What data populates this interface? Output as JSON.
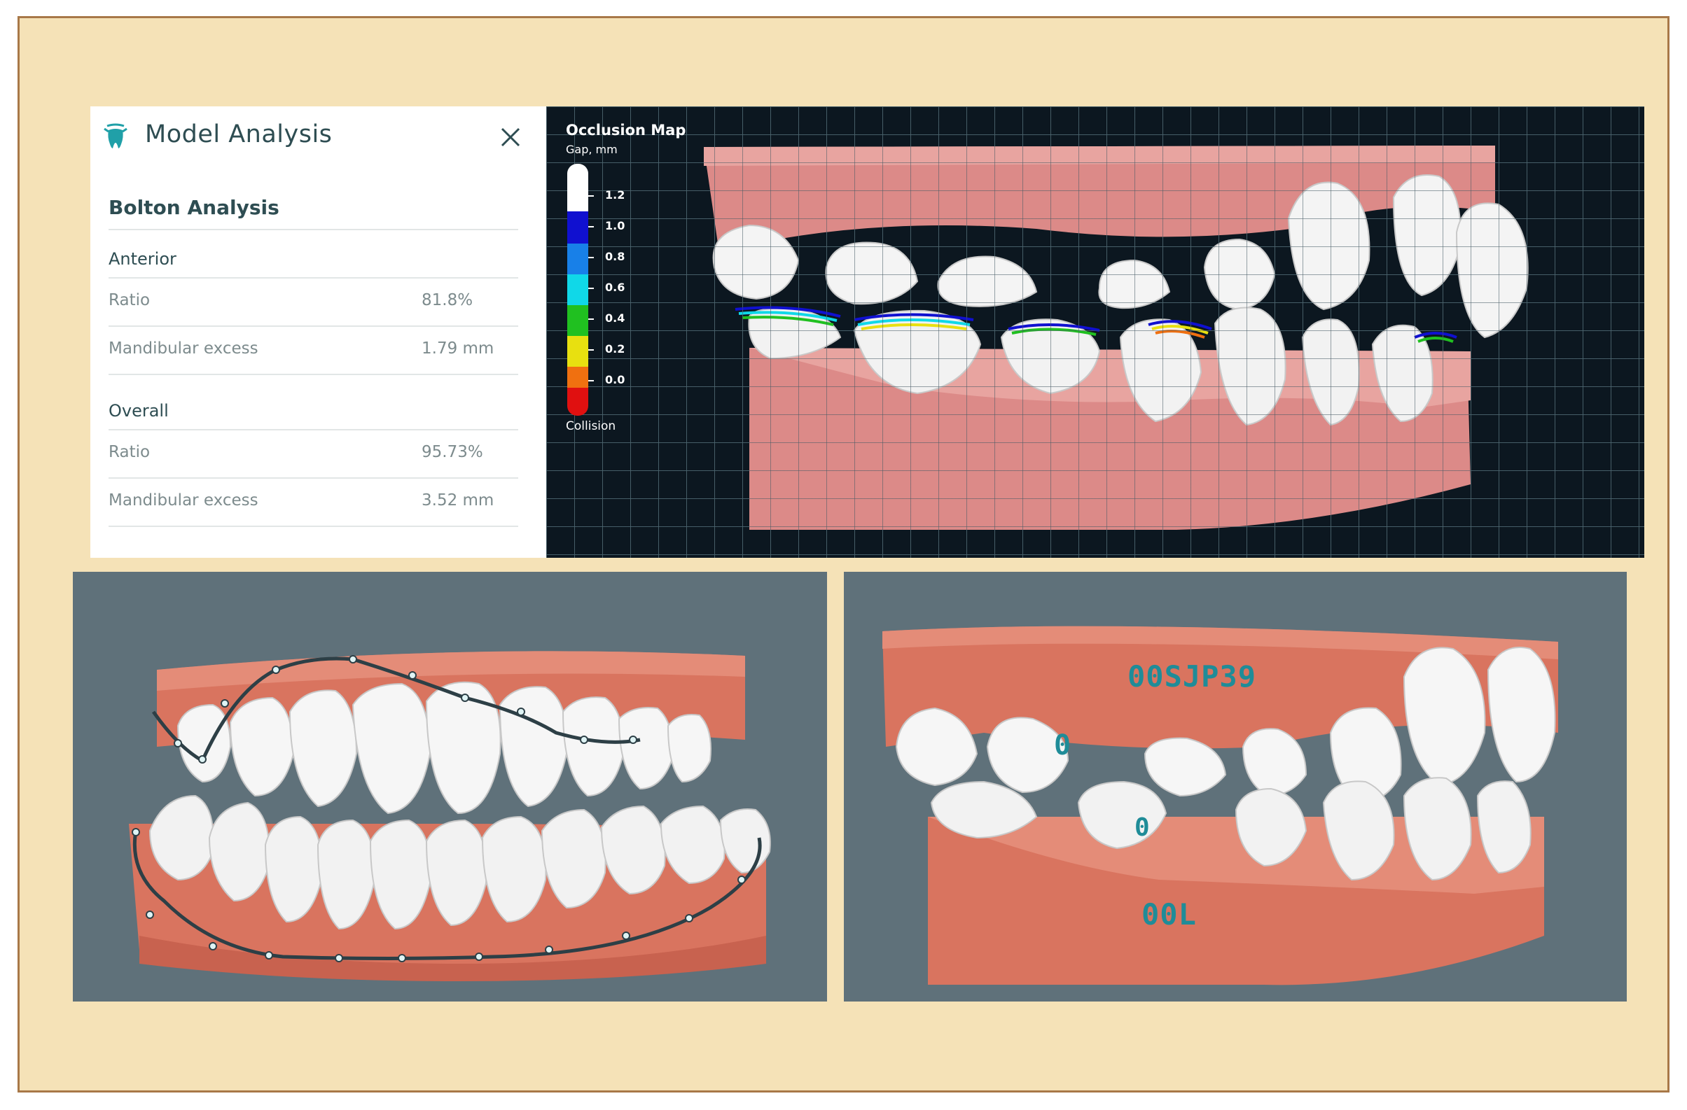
{
  "panel": {
    "title": "Model Analysis",
    "icon": "tooth-icon",
    "close_icon": "close-icon",
    "section": "Bolton Analysis",
    "groups": [
      {
        "label": "Anterior",
        "rows": [
          {
            "label": "Ratio",
            "value": "81.8%"
          },
          {
            "label": "Mandibular excess",
            "value": "1.79 mm"
          }
        ]
      },
      {
        "label": "Overall",
        "rows": [
          {
            "label": "Ratio",
            "value": "95.73%"
          },
          {
            "label": "Mandibular excess",
            "value": "3.52 mm"
          }
        ]
      }
    ]
  },
  "occlusion": {
    "title": "Occlusion Map",
    "subtitle": "Gap, mm",
    "ticks": [
      "1.2",
      "1.0",
      "0.8",
      "0.6",
      "0.4",
      "0.2",
      "0.0"
    ],
    "bottom_label": "Collision",
    "colors": [
      "#ffffff",
      "#1010d0",
      "#1880e8",
      "#10d8e8",
      "#20c020",
      "#e8e010",
      "#f07010",
      "#e01010"
    ]
  },
  "arch_view": {
    "markers": "landmark-points"
  },
  "labeled_view": {
    "upper_code": "00SJP39",
    "lower_code": "00L",
    "tooth_mark_upper": "0",
    "tooth_mark_lower": "0"
  }
}
